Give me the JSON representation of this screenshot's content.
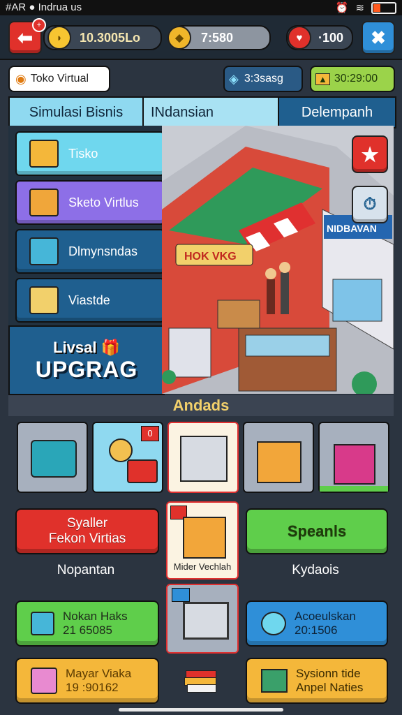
{
  "status_bar": {
    "left_text": "#AR",
    "carrier": "Indrua us"
  },
  "top_bar": {
    "coins": "10.3005Lo",
    "gems": "7:580",
    "hearts": "·100"
  },
  "sub_bar": {
    "store_name": "Toko Virtual",
    "badge1": "3:3sasg",
    "timer": "30:29:00"
  },
  "tabs": [
    "Simulasi Bisnis",
    "INdansian",
    "Delempanh"
  ],
  "side_menu": [
    {
      "label": "Tisko"
    },
    {
      "label": "Sketo Virtlus"
    },
    {
      "label": "Dlmynsndas"
    },
    {
      "label": "Viastde"
    }
  ],
  "upgrade": {
    "line1": "Livsal",
    "line2": "UPGRAG"
  },
  "scene": {
    "sign_shop": "HOK VKG",
    "sign_right": "NIDBAVAN"
  },
  "section_title": "Andads",
  "tiles": [
    {
      "badge": ""
    },
    {
      "badge": "0"
    },
    {
      "badge": ""
    },
    {
      "badge": ""
    },
    {
      "badge": ""
    }
  ],
  "mid": {
    "red_button": {
      "line1": "Syaller",
      "line2": "Fekon Virtias"
    },
    "green_button": "Speanls",
    "center_tile_label": "Mider Vechlah",
    "left_caption": "Nopantan",
    "right_caption": "Kydaois"
  },
  "stats": {
    "left_green": {
      "title": "Nokan Haks",
      "value": "21 65085"
    },
    "right_blue": {
      "title": "Acoeulskan",
      "value": "20:1506"
    },
    "left_yellow": {
      "title": "Mayar Viaka",
      "value": "19 :90162"
    },
    "right_yellow": {
      "title": "Sysionn tide",
      "value": "Anpel Naties"
    }
  },
  "colors": {
    "red": "#e0312b",
    "green": "#5fce4b",
    "blue": "#2f8fd8",
    "yellow": "#f4b73a",
    "cyan": "#6fd7ee",
    "purple": "#8d6fe7",
    "dark_blue": "#1f5f8f"
  }
}
